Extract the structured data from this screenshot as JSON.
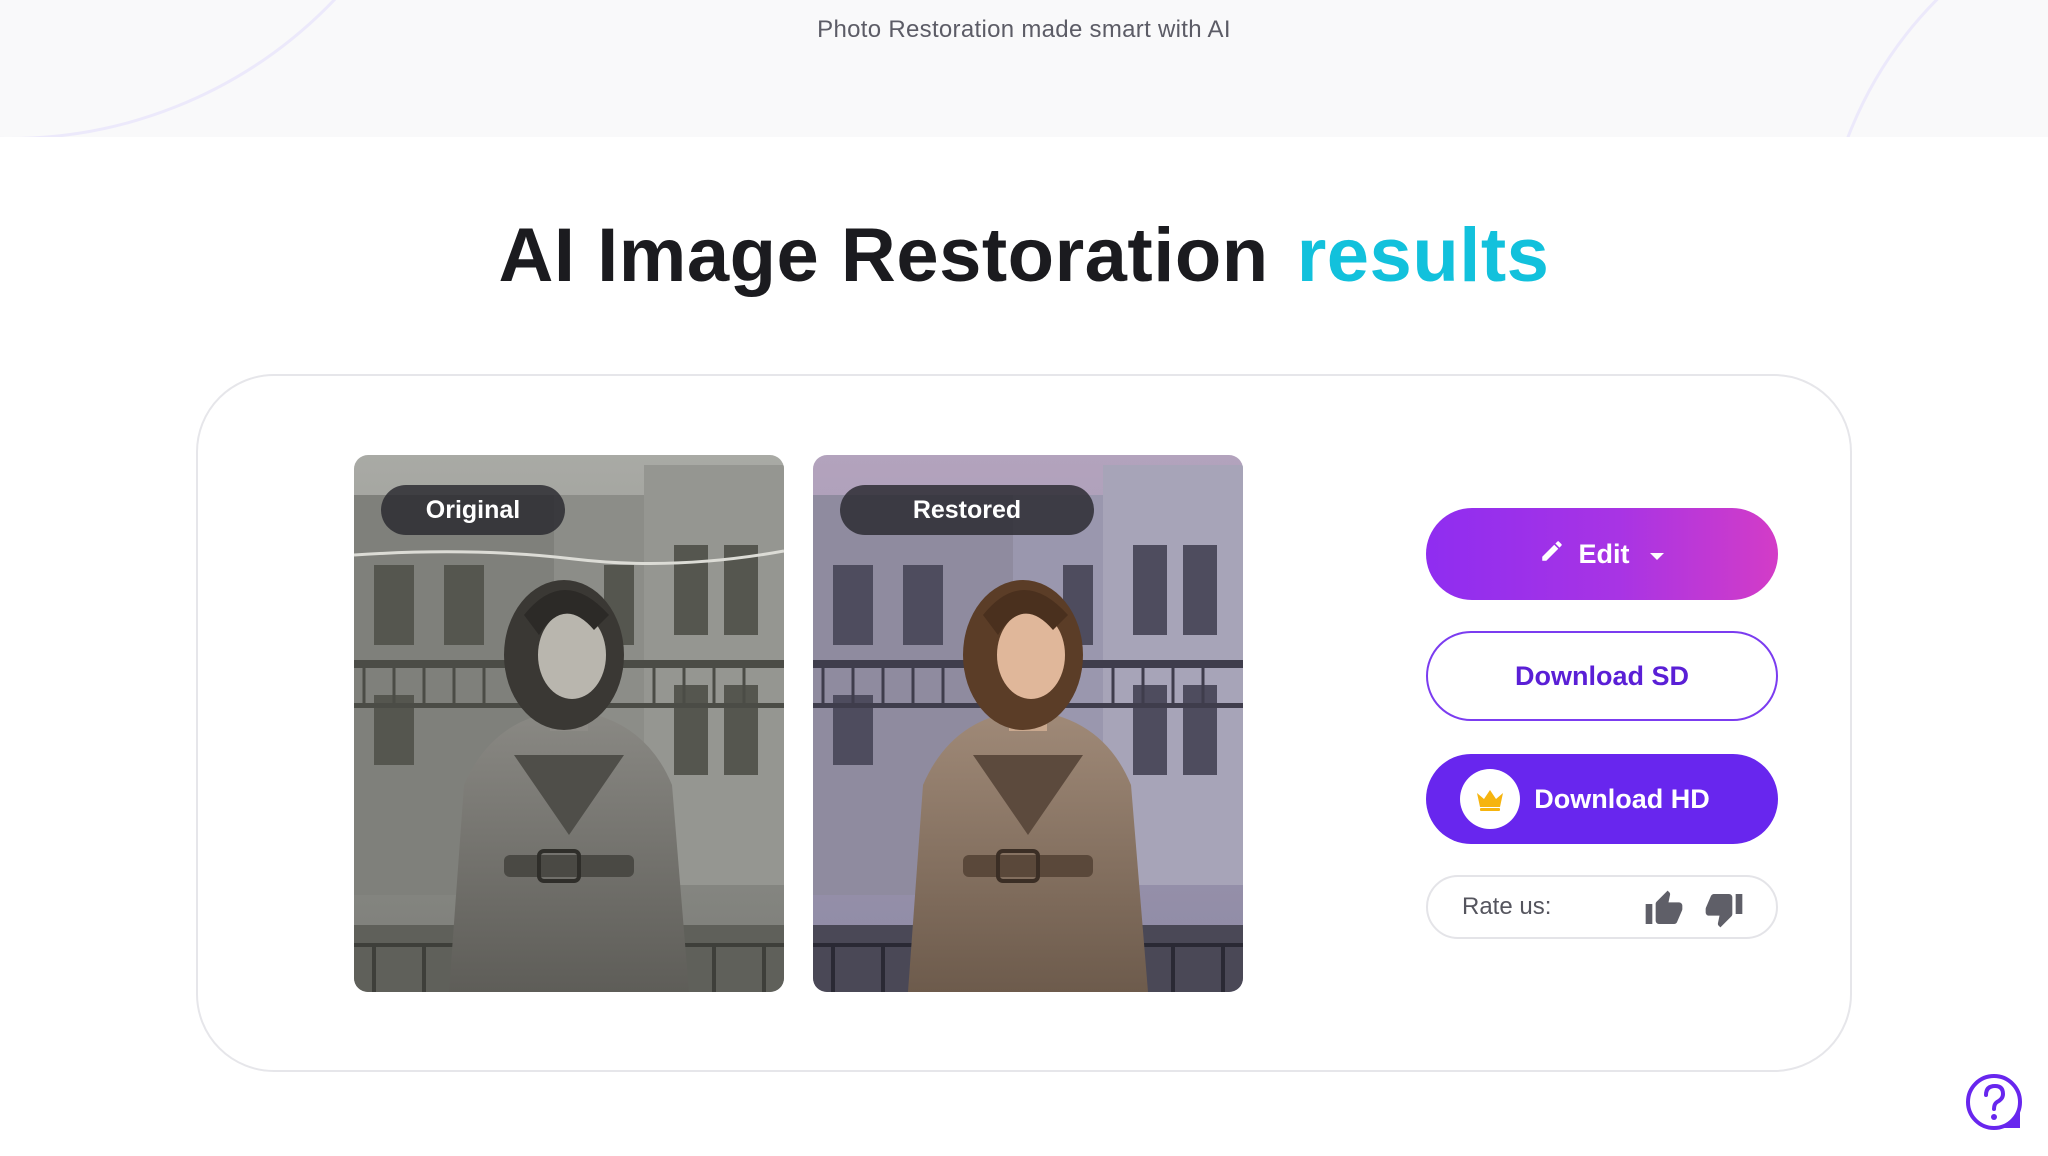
{
  "banner": {
    "tagline": "Photo Restoration made smart with AI"
  },
  "heading": {
    "main": "AI Image Restoration",
    "accent": "results"
  },
  "photos": {
    "original_label": "Original",
    "restored_label": "Restored"
  },
  "actions": {
    "edit_label": "Edit",
    "download_sd_label": "Download SD",
    "download_hd_label": "Download HD"
  },
  "rating": {
    "label": "Rate us:"
  },
  "colors": {
    "accent_cyan": "#12c1dc",
    "brand_purple": "#6826ee",
    "edit_gradient_start": "#8f2df0",
    "edit_gradient_end": "#d33cc7",
    "crown_gold": "#f6b40e"
  },
  "icons": {
    "edit": "pencil-icon",
    "edit_menu": "caret-down-icon",
    "premium": "crown-icon",
    "rate_up": "thumbs-up-icon",
    "rate_down": "thumbs-down-icon",
    "help": "help-icon"
  }
}
